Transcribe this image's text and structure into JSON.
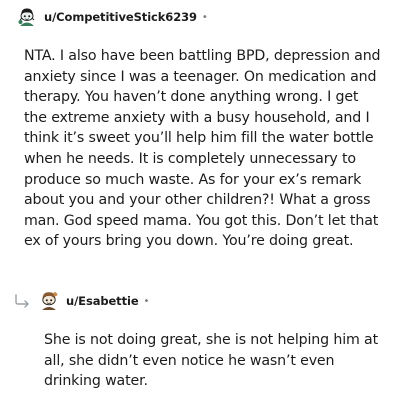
{
  "comment": {
    "username": "u/CompetitiveStick6239",
    "separator": "•",
    "avatar_icon": "snoo-avatar-green-icon",
    "body": "NTA. I also have been battling BPD, depression and anxiety since I was a teenager. On medication and therapy. You haven’t done anything wrong. I get the extreme anxiety with a busy household, and I think it’s sweet you’ll help him fill the water bottle when he needs. It is completely unnecessary to produce so much waste. As for your ex’s remark about you and your other children?! What a gross man. God speed mama. You got this. Don’t let that ex of yours bring you down. You’re doing great."
  },
  "reply": {
    "username": "u/Esabettie",
    "separator": "•",
    "avatar_icon": "snoo-avatar-brown-icon",
    "reply_icon": "reply-arrow-icon",
    "body": "She is not doing great, she is not helping him at all, she didn’t even notice he wasn’t even drinking water."
  },
  "colors": {
    "text": "#1c1c1c",
    "muted": "#7c7c7c",
    "thread_line": "#d7dadc"
  }
}
